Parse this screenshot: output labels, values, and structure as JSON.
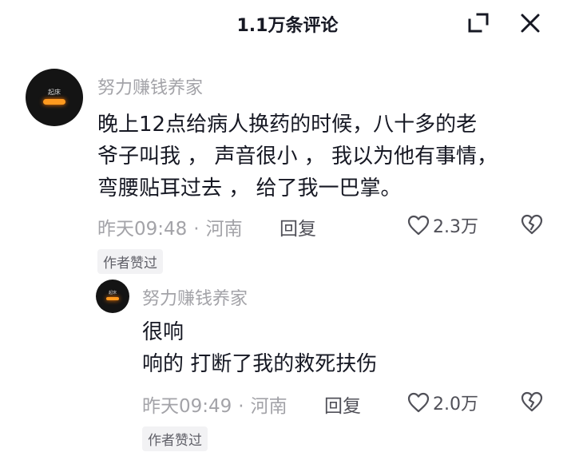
{
  "header": {
    "title": "1.1万条评论"
  },
  "comments": [
    {
      "username": "努力赚钱养家",
      "avatar_text": "起床",
      "lines": [
        "晚上12点给病人换药的时候，八十多的老",
        "爷子叫我 ， 声音很小 ， 我以为他有事情，",
        "弯腰贴耳过去 ， 给了我一巴掌。"
      ],
      "time": "昨天09:48",
      "separator": "·",
      "location": "河南",
      "reply_label": "回复",
      "likes": "2.3万",
      "author_badge": "作者赞过"
    },
    {
      "username": "努力赚钱养家",
      "avatar_text": "起床",
      "lines": [
        "很响",
        "响的 打断了我的救死扶伤"
      ],
      "time": "昨天09:49",
      "separator": "·",
      "location": "河南",
      "reply_label": "回复",
      "likes": "2.0万",
      "author_badge": "作者赞过"
    }
  ],
  "colors": {
    "text": "#161823",
    "secondary": "#a3a3a8",
    "avatar_accent": "#ff9a1f"
  },
  "icons": {
    "expand": "expand-icon",
    "close": "close-icon",
    "like": "heart-outline-icon",
    "dislike": "broken-heart-icon"
  }
}
